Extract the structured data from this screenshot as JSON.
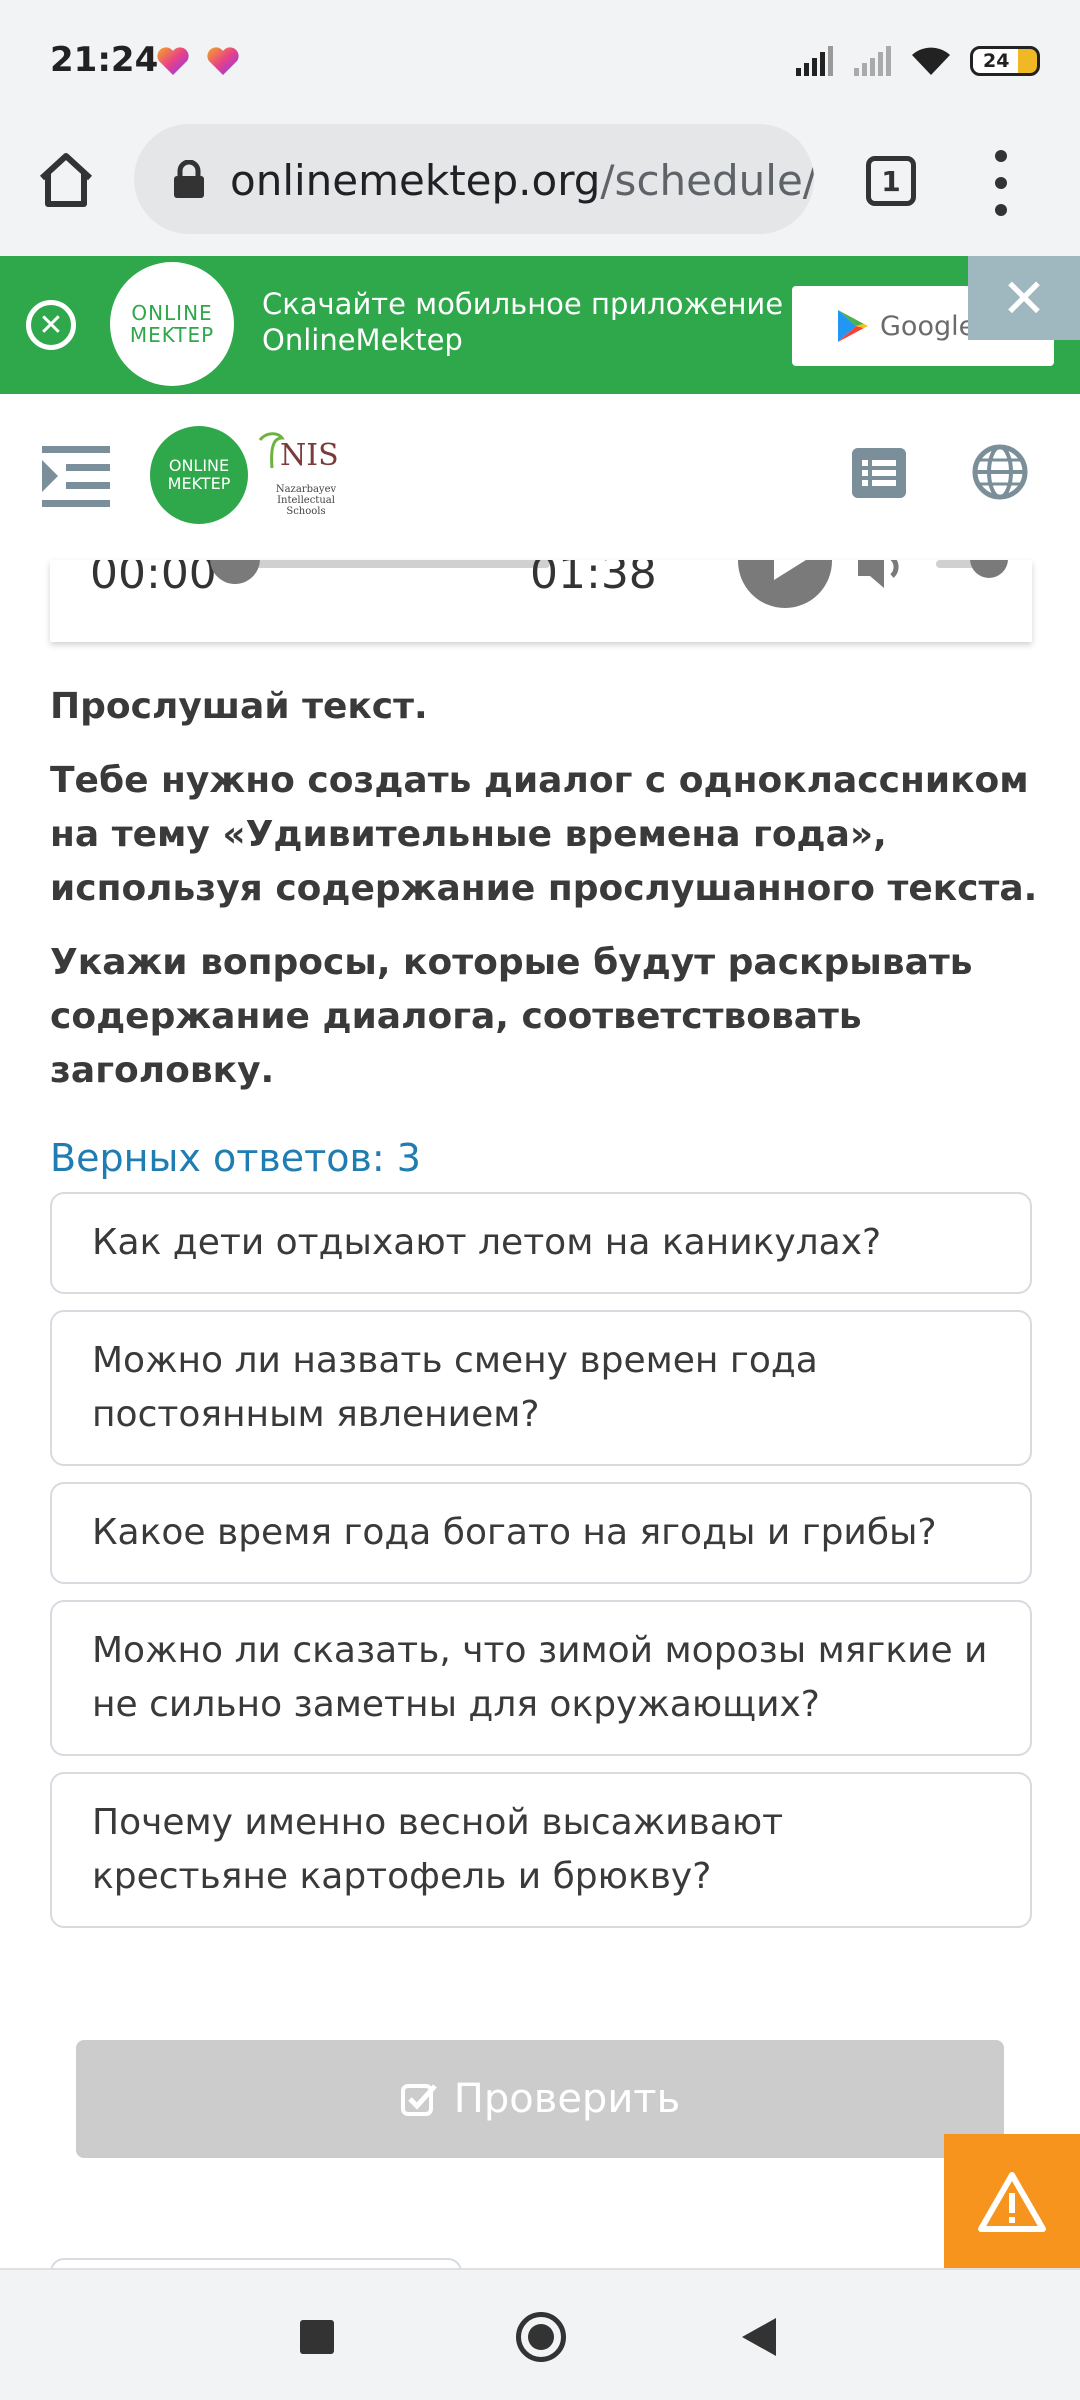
{
  "status_bar": {
    "time": "21:24",
    "battery": "24",
    "icons": [
      "heart-icon",
      "heart-icon",
      "signal-icon",
      "signal-empty-icon",
      "wifi-icon",
      "battery-icon"
    ]
  },
  "browser": {
    "url_host": "onlinemektep.org",
    "url_path": "/schedule/",
    "tab_count": "1"
  },
  "promo": {
    "logo_line1": "ONLINE",
    "logo_line2": "MEKTEP",
    "text_line1": "Скачайте мобильное приложение",
    "text_line2": "OnlineMektep",
    "store_label": "Google P"
  },
  "header": {
    "logo_line1": "ONLINE",
    "logo_line2": "MEKTEP",
    "nis_text": "NIS",
    "nis_sub": "Nazarbayev Intellectual Schools"
  },
  "audio": {
    "current_time": "00:00",
    "duration": "01:38",
    "progress": 0,
    "volume": 1.0
  },
  "question": {
    "p1": "Прослушай текст.",
    "p2": "Тебе нужно создать диалог с одноклассником на тему «Удивительные времена года», используя содержание прослушанного текста.",
    "p3": "Укажи вопросы, которые будут раскрывать содержание диалога, соответствовать заголовку."
  },
  "correct_answers": "Верных ответов: 3",
  "options": [
    "Как дети отдыхают летом на каникулах?",
    "Можно ли назвать смену времен года постоянным явлением?",
    "Какое время года богато на ягоды и грибы?",
    "Можно ли сказать, что зимой морозы мягкие и не сильно заметны для окружающих?",
    "Почему именно весной высаживают крестьяне картофель и брюкву?"
  ],
  "check_button": "Проверить",
  "colors": {
    "brand_green": "#2ea84a",
    "link_blue": "#1f7db1",
    "warning_orange": "#f7941d",
    "disabled_gray": "#cccccc"
  }
}
